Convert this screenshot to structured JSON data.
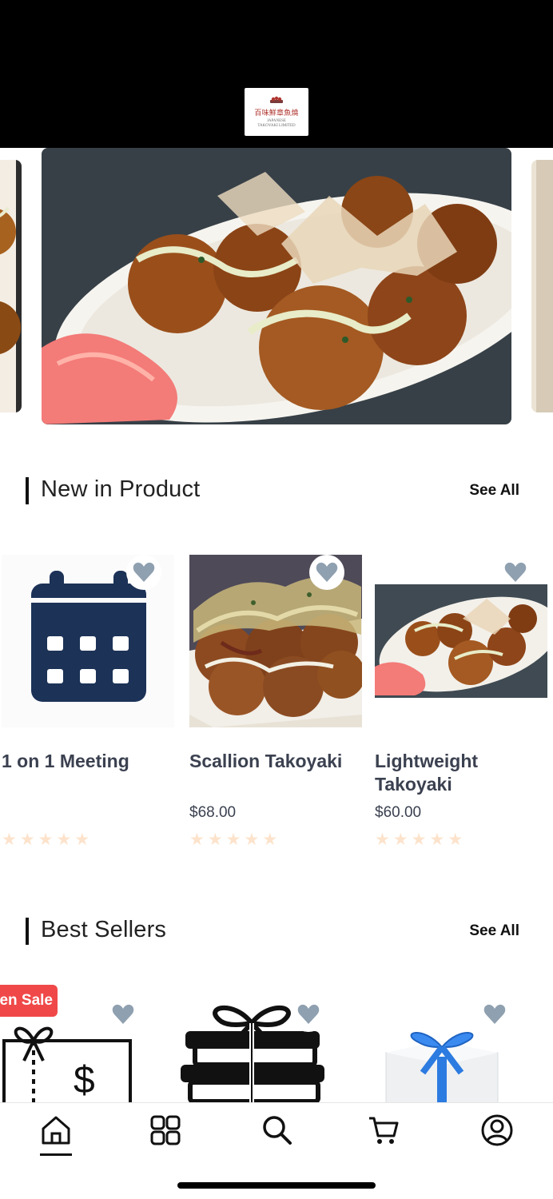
{
  "header": {
    "logo_cn": "百味鮮章魚燒",
    "logo_en_line1": "JAPANESE",
    "logo_en_line2": "TAKOYAKI LIMITED"
  },
  "sections": {
    "new_products": {
      "title": "New in Product",
      "see_all": "See All",
      "items": [
        {
          "name": "1 on 1 Meeting",
          "price": "",
          "icon": "calendar-icon",
          "rating": 0
        },
        {
          "name": "Scallion Takoyaki",
          "price": "$68.00",
          "icon": "takoyaki-photo",
          "rating": 0
        },
        {
          "name": "Lightweight Takoyaki",
          "price": "$60.00",
          "icon": "takoyaki-plate-photo",
          "rating": 0
        }
      ]
    },
    "best_sellers": {
      "title": "Best Sellers",
      "see_all": "See All",
      "badge": "en Sale",
      "items": [
        {
          "icon": "gift-card-icon"
        },
        {
          "icon": "gift-box-stack-icon"
        },
        {
          "icon": "gift-box-photo"
        }
      ]
    }
  },
  "tabbar": {
    "tabs": [
      {
        "name": "home",
        "icon": "home-icon",
        "active": true
      },
      {
        "name": "categories",
        "icon": "grid-icon",
        "active": false
      },
      {
        "name": "search",
        "icon": "search-icon",
        "active": false
      },
      {
        "name": "cart",
        "icon": "cart-icon",
        "active": false
      },
      {
        "name": "profile",
        "icon": "user-icon",
        "active": false
      }
    ]
  },
  "colors": {
    "header_bg": "#000000",
    "heart": "#8fa0b0",
    "star": "#fde3cc",
    "sale": "#f04848",
    "calendar": "#1c3257"
  }
}
